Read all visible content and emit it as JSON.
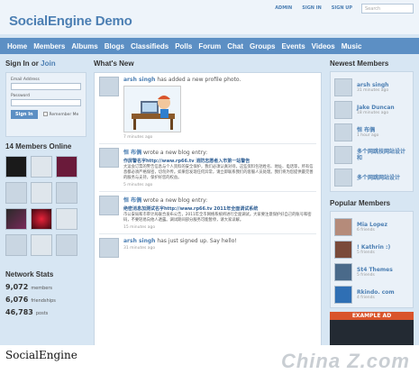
{
  "site": {
    "title": "SocialEngine Demo"
  },
  "toplinks": [
    "ADMIN",
    "SIGN IN",
    "SIGN UP"
  ],
  "search": {
    "placeholder": "Search"
  },
  "nav": [
    "Home",
    "Members",
    "Albums",
    "Blogs",
    "Classifieds",
    "Polls",
    "Forum",
    "Chat",
    "Groups",
    "Events",
    "Videos",
    "Music"
  ],
  "signin": {
    "heading": "Sign In",
    "or": "or",
    "join": "Join",
    "email_label": "Email Address",
    "password_label": "Password",
    "button": "Sign In",
    "remember": "Remember Me"
  },
  "online": {
    "heading": "14 Members Online"
  },
  "stats": {
    "heading": "Network Stats",
    "rows": [
      {
        "value": "9,072",
        "label": "members"
      },
      {
        "value": "6,076",
        "label": "friendships"
      },
      {
        "value": "46,783",
        "label": "posts"
      }
    ]
  },
  "whatsnew": {
    "heading": "What's New",
    "items": [
      {
        "name": "arsh singh",
        "action": "has added a new profile photo.",
        "time": "7 minutes ago"
      },
      {
        "name": "恒 布偶",
        "action": "wrote a new blog entry:",
        "title": "作屏警名字http://www.rp66.tv 消防志愿者入市第一站警告",
        "text": "大运会订票的警告信息与个人资料的安全保护，我们必须认真对待。这些资料包括姓名、地址、电话等，所有信息都必须严格保密，切勿外传。如果您发现任何异常，请立即联系我们的客服人员处理。我们将为您提供最完善的服务与支持，保护好您的权益。",
        "time": "5 minutes ago"
      },
      {
        "name": "恒 布偶",
        "action": "wrote a new blog entry:",
        "title": "绝密消息加测试名字http://www.rp66.tv 2011年全面调试系统",
        "text": "市公安局和市审计局联合发布公告，2011年全市网络系统将进行全面调试。大家要注意保护好自己的账号和密码，不要轻易向他人透露。调试期间部分服务可能暂停，请大家谅解。",
        "time": "15 minutes ago"
      },
      {
        "name": "arsh singh",
        "action": "has just signed up. Say hello!",
        "time": "31 minutes ago"
      }
    ]
  },
  "newest": {
    "heading": "Newest Members",
    "items": [
      {
        "name": "arsh singh",
        "sub": "31 minutes ago"
      },
      {
        "name": "Jake Duncan",
        "sub": "18 minutes ago"
      },
      {
        "name": "恒 布偶",
        "sub": "1 hour ago"
      },
      {
        "name": "多个网跳技网站设计和",
        "sub": ""
      },
      {
        "name": "多个网跳网站设计",
        "sub": ""
      }
    ]
  },
  "popular": {
    "heading": "Popular Members",
    "items": [
      {
        "name": "Mia Lopez",
        "sub": "6 friends"
      },
      {
        "name": "! Kathrin :)",
        "sub": "5 friends"
      },
      {
        "name": "St4 Themes",
        "sub": "5 friends"
      },
      {
        "name": "Rkindo. com",
        "sub": "4 friends"
      }
    ]
  },
  "ad": {
    "label": "EXAMPLE AD"
  },
  "caption": "SocialEngine",
  "watermark": "China Z.com"
}
